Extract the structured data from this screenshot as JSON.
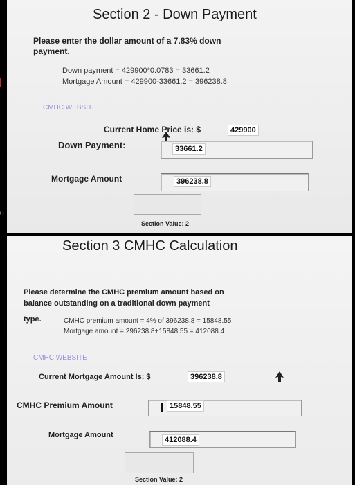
{
  "section2": {
    "title": "Section 2 - Down Payment",
    "instruction_line1": "Please enter the dollar amount of a 7.83% down",
    "instruction_line2": "payment.",
    "note_line1": "Down payment = 429900*0.0783 = 33661.2",
    "note_line2": "Mortgage Amount = 429900-33661.2 = 396238.8",
    "link": "CMHC WEBSITE",
    "home_price_label": "Current Home Price is: $",
    "home_price_value": "429900",
    "down_payment_label": "Down Payment:",
    "down_payment_value": "33661.2",
    "mortgage_label": "Mortgage Amount",
    "mortgage_value": "396238.8",
    "section_value_label": "Section Value: 2"
  },
  "section3": {
    "title": "Section 3 CMHC Calculation",
    "instruction_line1": "Please determine the CMHC premium amount based on",
    "instruction_line2": "balance outstanding on a traditional down payment",
    "instruction_line3": "type.",
    "note_line1": "CMHC premium amount = 4% of 396238.8 = 15848.55",
    "note_line2": "Mortgage amount = 296238.8+15848.55 = 412088.4",
    "link": "CMHC WEBSITE",
    "current_mortgage_label": "Current Mortgage Amount Is: $",
    "current_mortgage_value": "396238.8",
    "premium_label": "CMHC Premium Amount",
    "premium_value": "15848.55",
    "mortgage_label": "Mortgage Amount",
    "mortgage_value": "412088.4",
    "section_value_label": "Section Value: 2"
  },
  "margin_marker": "0"
}
